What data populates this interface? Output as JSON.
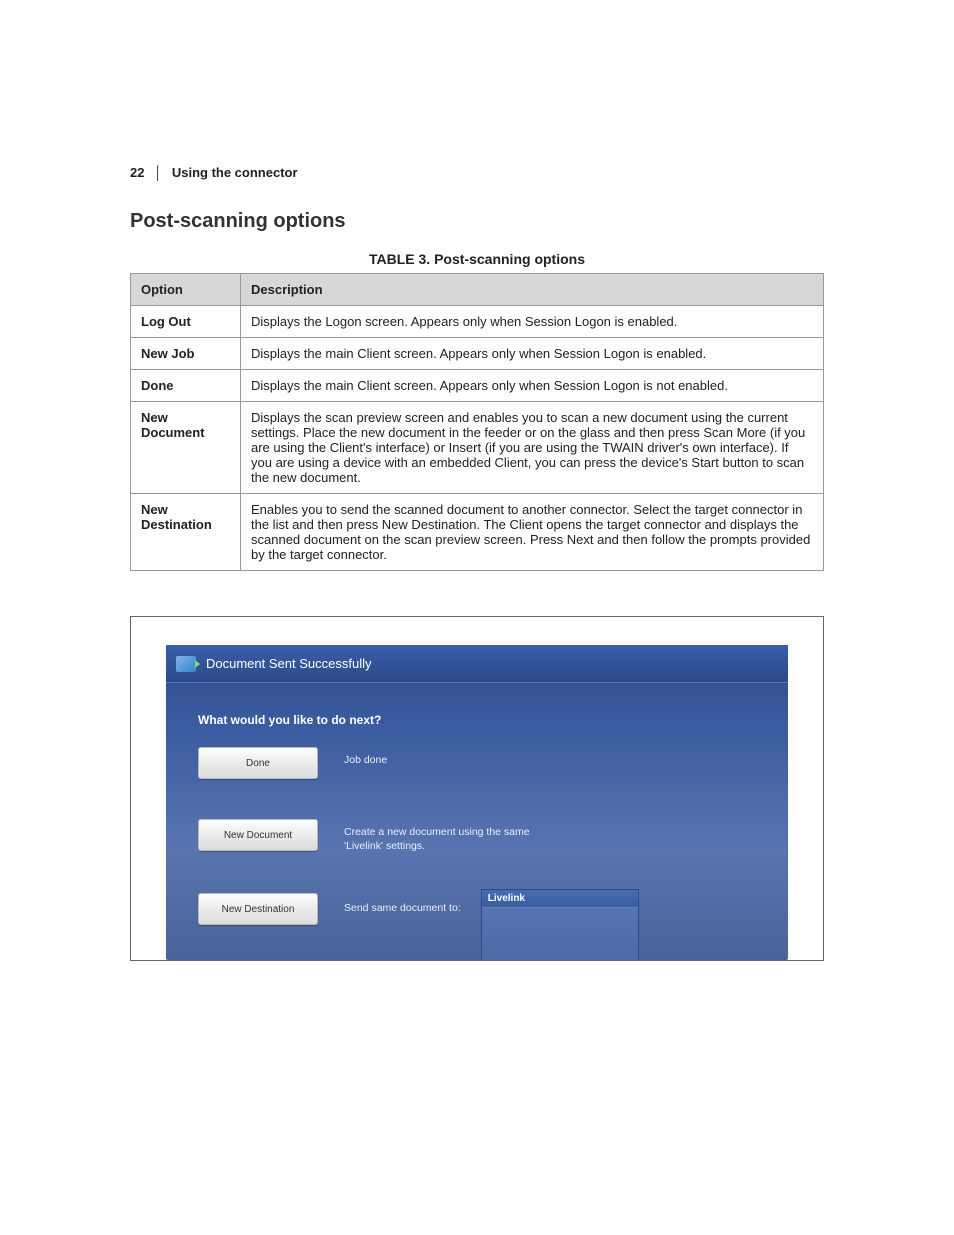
{
  "page": {
    "number": "22",
    "chapter": "Using the connector"
  },
  "section_title": "Post-scanning options",
  "table": {
    "caption_label": "TABLE 3.",
    "caption_text": "Post-scanning options",
    "headers": {
      "option": "Option",
      "description": "Description"
    },
    "rows": [
      {
        "option": "Log Out",
        "description": "Displays the Logon screen. Appears only when Session Logon is enabled."
      },
      {
        "option": "New Job",
        "description": "Displays the main Client screen. Appears only when Session Logon is enabled."
      },
      {
        "option": "Done",
        "description": "Displays the main Client screen. Appears only when Session Logon is not enabled."
      },
      {
        "option": "New Document",
        "description": "Displays the scan preview screen and enables you to scan a new document using the current settings. Place the new document in the feeder or on the glass and then press Scan More (if you are using the Client's interface) or Insert (if you are using the TWAIN driver's own interface). If you are using a device with an embedded Client, you can press the device's Start button to scan the new document."
      },
      {
        "option": "New Destination",
        "description": "Enables you to send the scanned document to another connector. Select the target connector in the list and then press New Destination. The Client opens the target connector and displays the scanned document on the scan preview screen. Press Next and then follow the prompts provided by the target connector."
      }
    ]
  },
  "app": {
    "title": "Document Sent Successfully",
    "prompt": "What would you like to do next?",
    "buttons": {
      "done": {
        "label": "Done",
        "desc": "Job done"
      },
      "newdoc": {
        "label": "New Document",
        "desc": "Create a new document using the same 'Livelink' settings."
      },
      "newdest": {
        "label": "New Destination",
        "desc": "Send same document to:"
      }
    },
    "dest_item": "Livelink"
  }
}
